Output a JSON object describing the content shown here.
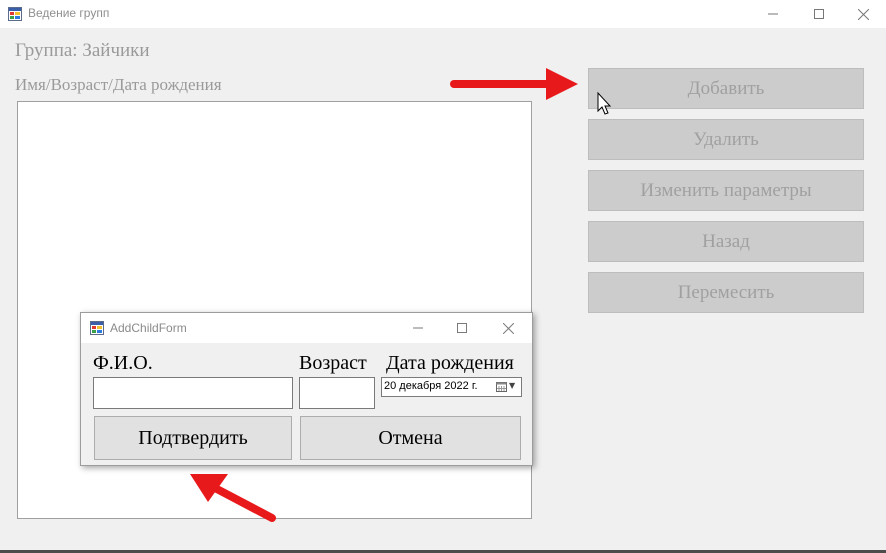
{
  "window": {
    "title": "Ведение групп",
    "icon": "app-form-icon"
  },
  "main": {
    "group_label": "Группа: Зайчики",
    "columns_label": "Имя/Возраст/Дата рождения"
  },
  "buttons": {
    "add": "Добавить",
    "delete": "Удалить",
    "edit_params": "Изменить параметры",
    "back": "Назад",
    "move": "Перемесить"
  },
  "dialog": {
    "title": "AddChildForm",
    "fio_label": "Ф.И.О.",
    "age_label": "Возраст",
    "dob_label": "Дата рождения",
    "fio_value": "",
    "age_value": "",
    "dob_value": "20  декабря  2022 г.",
    "confirm": "Подтвердить",
    "cancel": "Отмена"
  },
  "annotations": {
    "arrow_color": "#e8191b"
  }
}
